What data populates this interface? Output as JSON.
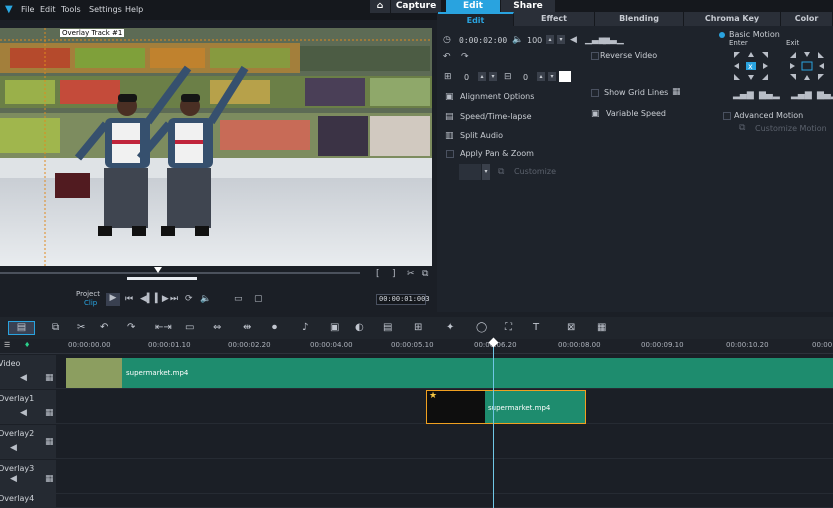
{
  "menu": [
    "File",
    "Edit",
    "Tools",
    "Settings",
    "Help"
  ],
  "modes": {
    "capture": "Capture",
    "edit": "Edit",
    "share": "Share"
  },
  "preview": {
    "overlay_tag": "Overlay Track #1",
    "project_label": "Project",
    "clip_label": "Clip",
    "timecode": "00:00:01:003"
  },
  "panel": {
    "tabs": [
      "Edit",
      "Effect",
      "Blending",
      "Chroma Key",
      "Color"
    ],
    "duration": "0:00:02:00",
    "volume": "100",
    "rot1": "0",
    "rot2": "0",
    "reverse_video": "Reverse Video",
    "alignment_options": "Alignment Options",
    "show_grid_lines": "Show Grid Lines",
    "speed_timelapse": "Speed/Time-lapse",
    "variable_speed": "Variable Speed",
    "split_audio": "Split Audio",
    "apply_pan_zoom": "Apply Pan & Zoom",
    "customize": "Customize",
    "basic_motion": "Basic Motion",
    "enter": "Enter",
    "exit": "Exit",
    "advanced_motion": "Advanced Motion",
    "customize_motion": "Customize Motion"
  },
  "ruler": [
    "00:00:00.00",
    "00:00:01.10",
    "00:00:02.20",
    "00:00:04.00",
    "00:00:05.10",
    "00:00:06.20",
    "00:00:08.00",
    "00:00:09.10",
    "00:00:10.20",
    "00:00:1"
  ],
  "tracks": [
    {
      "name": "Video",
      "clip": "supermarket.mp4"
    },
    {
      "name": "Overlay1",
      "clip": "supermarket.mp4"
    },
    {
      "name": "Overlay2",
      "clip": ""
    },
    {
      "name": "Overlay3",
      "clip": ""
    },
    {
      "name": "Overlay4",
      "clip": ""
    }
  ],
  "colors": {
    "accent": "#29a3df",
    "clip_green": "#1e8c6e",
    "panel_bg": "#1e232b"
  }
}
